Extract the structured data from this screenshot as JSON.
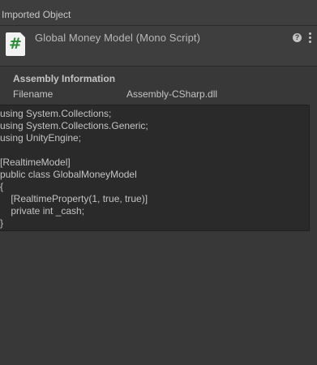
{
  "panel": {
    "title": "Imported Object"
  },
  "object": {
    "icon": "csharp-script-icon",
    "icon_glyph": "#",
    "title": "Global Money Model (Mono Script)",
    "help_glyph": "?",
    "accent_color": "#2f8a3c"
  },
  "assembly": {
    "section_title": "Assembly Information",
    "filename_label": "Filename",
    "filename_value": "Assembly-CSharp.dll"
  },
  "code": {
    "lines": [
      "using System.Collections;",
      "using System.Collections.Generic;",
      "using UnityEngine;",
      "",
      "[RealtimeModel]",
      "public class GlobalMoneyModel",
      "{",
      "    [RealtimeProperty(1, true, true)]",
      "    private int _cash;",
      "}"
    ]
  }
}
